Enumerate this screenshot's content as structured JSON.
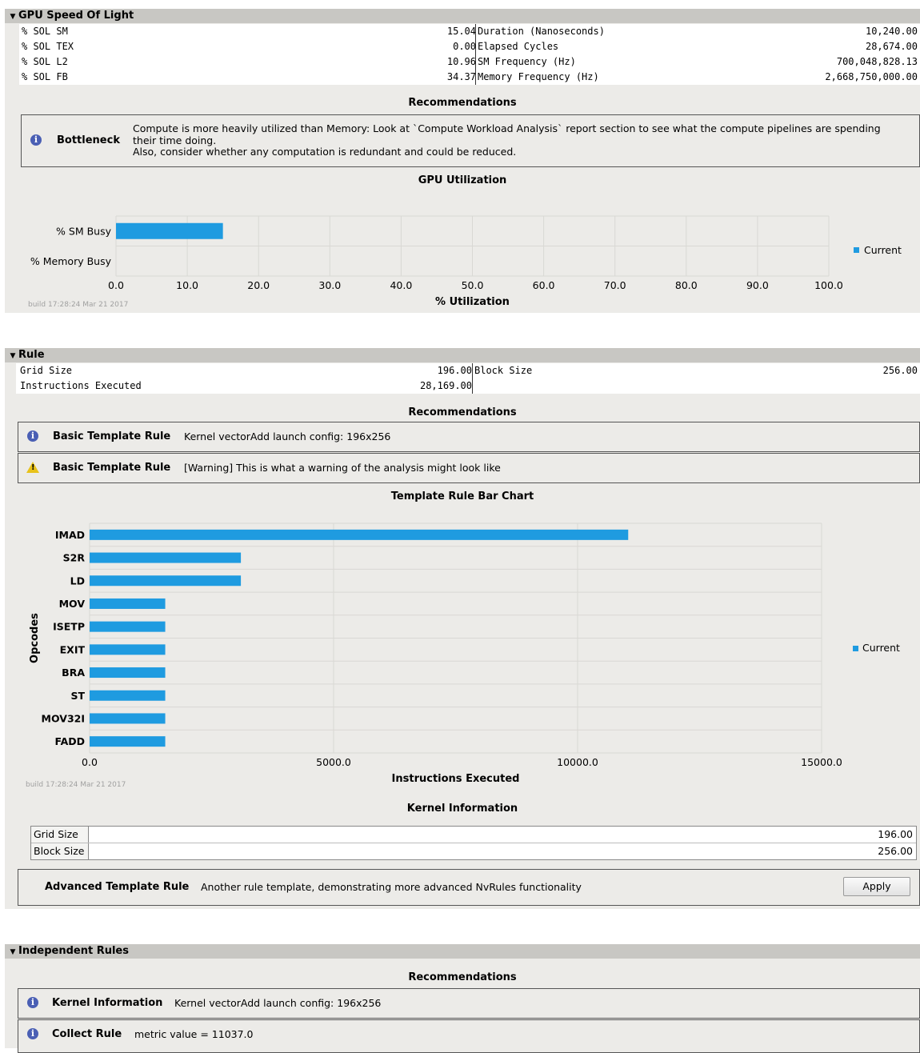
{
  "sol": {
    "title": "GPU Speed Of Light",
    "rows": [
      {
        "left_label": "% SOL SM",
        "left_value": "15.04",
        "right_label": "Duration (Nanoseconds)",
        "right_value": "10,240.00"
      },
      {
        "left_label": "% SOL TEX",
        "left_value": "0.00",
        "right_label": "Elapsed Cycles",
        "right_value": "28,674.00"
      },
      {
        "left_label": "% SOL L2",
        "left_value": "10.96",
        "right_label": "SM Frequency (Hz)",
        "right_value": "700,048,828.13"
      },
      {
        "left_label": "% SOL FB",
        "left_value": "34.37",
        "right_label": "Memory Frequency (Hz)",
        "right_value": "2,668,750,000.00"
      }
    ],
    "recommendations_title": "Recommendations",
    "bottleneck": {
      "title": "Bottleneck",
      "line1": "Compute is more heavily utilized than Memory: Look at `Compute Workload Analysis` report section to see what the compute pipelines are spending",
      "line2": "their time doing.",
      "line3": "Also, consider whether any computation is redundant and could be reduced.",
      "icon": "info-icon"
    },
    "build_label": "build 17:28:24 Mar 21 2017",
    "legend_label": "Current"
  },
  "rule": {
    "title": "Rule",
    "rows": [
      {
        "left_label": "Grid Size",
        "left_value": "196.00",
        "right_label": "Block Size",
        "right_value": "256.00"
      },
      {
        "left_label": "Instructions Executed",
        "left_value": "28,169.00",
        "right_label": "",
        "right_value": ""
      }
    ],
    "recommendations_title": "Recommendations",
    "rec1": {
      "title": "Basic Template Rule",
      "text": "Kernel vectorAdd launch config: 196x256",
      "icon": "info-icon"
    },
    "rec2": {
      "title": "Basic Template Rule",
      "text": "[Warning] This is what a warning of the analysis might look like",
      "icon": "warning-icon"
    },
    "build_label": "build 17:28:24 Mar 21 2017",
    "legend_label": "Current",
    "kernel_info_title": "Kernel Information",
    "kernel_table": [
      {
        "label": "Grid Size",
        "value": "196.00"
      },
      {
        "label": "Block Size",
        "value": "256.00"
      }
    ],
    "advanced": {
      "title": "Advanced Template Rule",
      "text": "Another rule template, demonstrating more advanced NvRules functionality",
      "button": "Apply"
    }
  },
  "independent": {
    "title": "Independent Rules",
    "recommendations_title": "Recommendations",
    "rec1": {
      "title": "Kernel Information",
      "text": "Kernel vectorAdd launch config: 196x256",
      "icon": "info-icon"
    },
    "rec2": {
      "title": "Collect Rule",
      "text": "metric value = 11037.0",
      "icon": "info-icon"
    }
  },
  "colors": {
    "bar": "#1f9be0",
    "section_header": "#c8c7c3",
    "panel": "#ecebe8"
  },
  "chart_data": [
    {
      "type": "bar",
      "orientation": "horizontal",
      "title": "GPU Utilization",
      "categories": [
        "% SM Busy",
        "% Memory Busy"
      ],
      "series": [
        {
          "name": "Current",
          "values": [
            15.0,
            0.0
          ]
        }
      ],
      "xlabel": "% Utilization",
      "ylabel": "",
      "xlim": [
        0,
        100
      ],
      "x_ticks": [
        "0.0",
        "10.0",
        "20.0",
        "30.0",
        "40.0",
        "50.0",
        "60.0",
        "70.0",
        "80.0",
        "90.0",
        "100.0"
      ],
      "grid": true,
      "legend": "right"
    },
    {
      "type": "bar",
      "orientation": "horizontal",
      "title": "Template Rule Bar Chart",
      "categories": [
        "IMAD",
        "S2R",
        "LD",
        "MOV",
        "ISETP",
        "EXIT",
        "BRA",
        "ST",
        "MOV32I",
        "FADD"
      ],
      "series": [
        {
          "name": "Current",
          "values": [
            11037,
            3100,
            3100,
            1550,
            1550,
            1550,
            1550,
            1550,
            1550,
            1550
          ]
        }
      ],
      "xlabel": "Instructions Executed",
      "ylabel": "Opcodes",
      "xlim": [
        0,
        15000
      ],
      "x_ticks": [
        "0.0",
        "5000.0",
        "10000.0",
        "15000.0"
      ],
      "grid": true,
      "legend": "right"
    }
  ]
}
